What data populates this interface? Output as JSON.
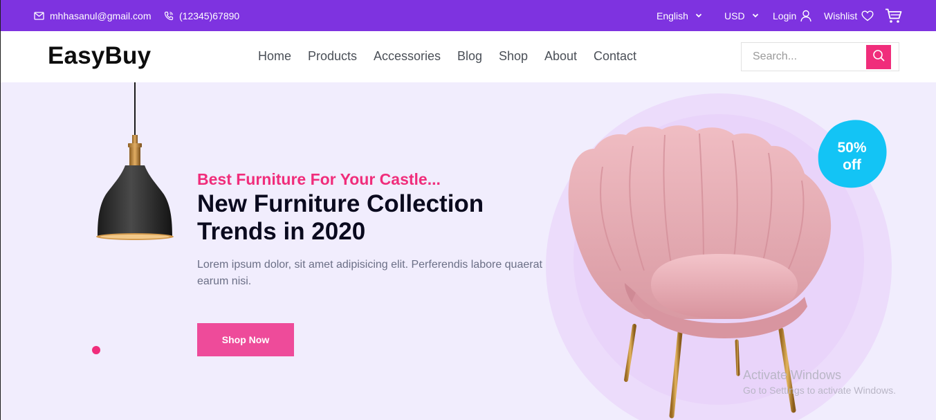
{
  "topbar": {
    "email": "mhhasanul@gmail.com",
    "phone": "(12345)67890",
    "language": "English",
    "currency": "USD",
    "login": "Login",
    "wishlist": "Wishlist",
    "icons": [
      "mail-icon",
      "phone-icon",
      "chevron-down-icon",
      "user-icon",
      "heart-icon",
      "cart-icon"
    ],
    "background_color": "#7e33e0"
  },
  "header": {
    "logo": "EasyBuy",
    "nav": [
      "Home",
      "Products",
      "Accessories",
      "Blog",
      "Shop",
      "About",
      "Contact"
    ],
    "search": {
      "placeholder": "Search...",
      "value": "",
      "button_color": "#f02d7b"
    }
  },
  "hero": {
    "subtitle": "Best Furniture For Your Castle...",
    "title_line1": "New Furniture Collection",
    "title_line2": "Trends in 2020",
    "description": "Lorem ipsum dolor, sit amet adipisicing elit. Perferendis labore quaerat earum nisi.",
    "button": "Shop Now",
    "badge_line1": "50%",
    "badge_line2": "off",
    "accent_color": "#f02d7b",
    "background_color": "#f1edfd",
    "images": [
      "pendant-lamp-image",
      "pink-armchair-image"
    ]
  },
  "watermark": {
    "line1": "Activate Windows",
    "line2": "Go to Settings to activate Windows."
  }
}
